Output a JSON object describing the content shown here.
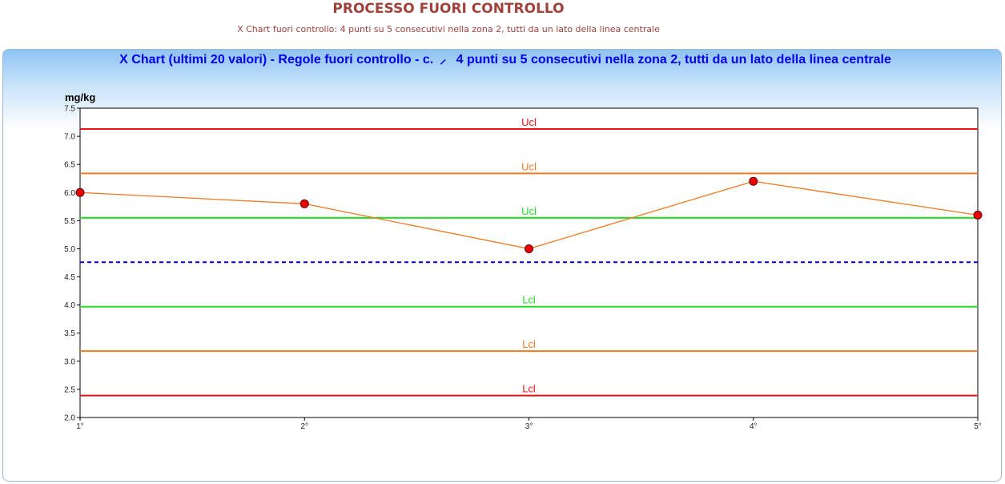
{
  "header": {
    "title": "PROCESSO FUORI CONTROLLO",
    "subtitle": "X Chart fuori controllo: 4 punti su 5 consecutivi nella zona 2, tutti da un lato della linea centrale"
  },
  "chart_data": {
    "type": "line",
    "title": "X Chart (ultimi 20 valori) - Regole fuori controllo - c. ⸝  4 punti su 5 consecutivi nella zona 2, tutti da un lato della linea centrale",
    "ylabel": "mg/kg",
    "xlabel": "",
    "ylim": [
      2.0,
      7.5
    ],
    "yticks": [
      "2.0",
      "2.5",
      "3.0",
      "3.5",
      "4.0",
      "4.5",
      "5.0",
      "5.5",
      "6.0",
      "6.5",
      "7.0",
      "7.5"
    ],
    "categories": [
      "1°",
      "2°",
      "3°",
      "4°",
      "5°"
    ],
    "series": [
      {
        "values": [
          6.0,
          5.8,
          5.0,
          6.2,
          5.6
        ],
        "line_color": "#f07820",
        "marker_color": "#ee0000"
      }
    ],
    "center_line": {
      "value": 4.76,
      "color": "#0000cc",
      "style": "dashed"
    },
    "limit_lines": [
      {
        "label": "Ucl",
        "value": 7.13,
        "color": "#ee1111"
      },
      {
        "label": "Ucl",
        "value": 6.34,
        "color": "#f07820"
      },
      {
        "label": "Ucl",
        "value": 5.55,
        "color": "#22dd22"
      },
      {
        "label": "Lcl",
        "value": 3.97,
        "color": "#22dd22"
      },
      {
        "label": "Lcl",
        "value": 3.18,
        "color": "#f07820"
      },
      {
        "label": "Lcl",
        "value": 2.39,
        "color": "#ee1111"
      }
    ],
    "grid": false,
    "legend": "none"
  }
}
